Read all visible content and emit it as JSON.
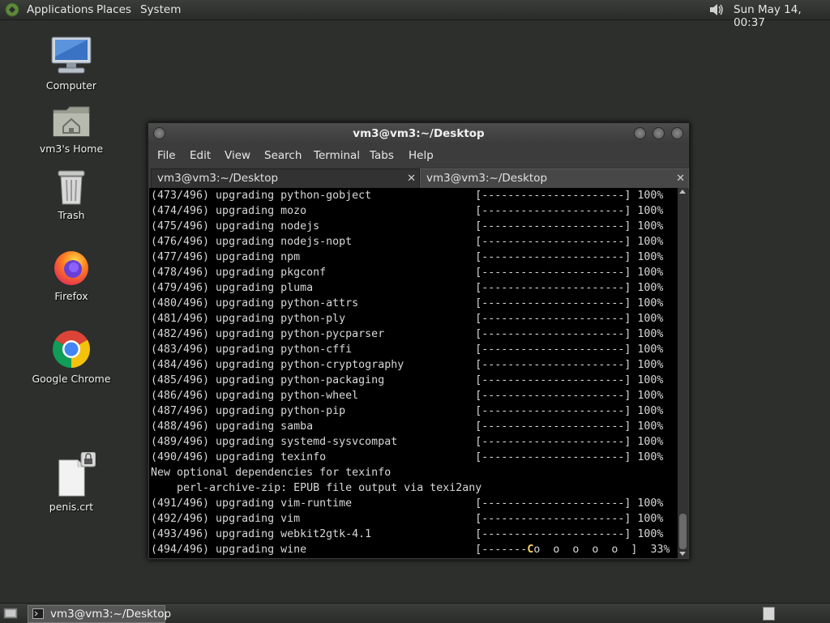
{
  "top_panel": {
    "applications": "Applications",
    "places": "Places",
    "system": "System",
    "clock": "Sun May 14, 00:37"
  },
  "desktop_icons": {
    "computer": "Computer",
    "home": "vm3's Home",
    "trash": "Trash",
    "firefox": "Firefox",
    "chrome": "Google Chrome",
    "cert": "penis.crt"
  },
  "terminal": {
    "title": "vm3@vm3:~/Desktop",
    "menu": [
      "File",
      "Edit",
      "View",
      "Search",
      "Terminal",
      "Tabs",
      "Help"
    ],
    "tabs": [
      "vm3@vm3:~/Desktop",
      "vm3@vm3:~/Desktop"
    ],
    "lines": [
      "(473/496) upgrading python-gobject                [----------------------] 100%",
      "(474/496) upgrading mozo                          [----------------------] 100%",
      "(475/496) upgrading nodejs                        [----------------------] 100%",
      "(476/496) upgrading nodejs-nopt                   [----------------------] 100%",
      "(477/496) upgrading npm                           [----------------------] 100%",
      "(478/496) upgrading pkgconf                       [----------------------] 100%",
      "(479/496) upgrading pluma                         [----------------------] 100%",
      "(480/496) upgrading python-attrs                  [----------------------] 100%",
      "(481/496) upgrading python-ply                    [----------------------] 100%",
      "(482/496) upgrading python-pycparser              [----------------------] 100%",
      "(483/496) upgrading python-cffi                   [----------------------] 100%",
      "(484/496) upgrading python-cryptography           [----------------------] 100%",
      "(485/496) upgrading python-packaging              [----------------------] 100%",
      "(486/496) upgrading python-wheel                  [----------------------] 100%",
      "(487/496) upgrading python-pip                    [----------------------] 100%",
      "(488/496) upgrading samba                         [----------------------] 100%",
      "(489/496) upgrading systemd-sysvcompat            [----------------------] 100%",
      "(490/496) upgrading texinfo                       [----------------------] 100%",
      "New optional dependencies for texinfo",
      "    perl-archive-zip: EPUB file output via texi2any",
      "(491/496) upgrading vim-runtime                   [----------------------] 100%",
      "(492/496) upgrading vim                           [----------------------] 100%",
      "(493/496) upgrading webkit2gtk-4.1                [----------------------] 100%"
    ],
    "last_prefix": "(494/496) upgrading wine                          [-------",
    "pacman": "C",
    "last_suffix": "o  o  o  o  o  ]  33%"
  },
  "taskbar": {
    "window_button": "vm3@vm3:~/Desktop"
  },
  "colors": {
    "desktop_bg": "#2c2f2c",
    "terminal_bg": "#000000",
    "pacman": "#ffd75f"
  }
}
